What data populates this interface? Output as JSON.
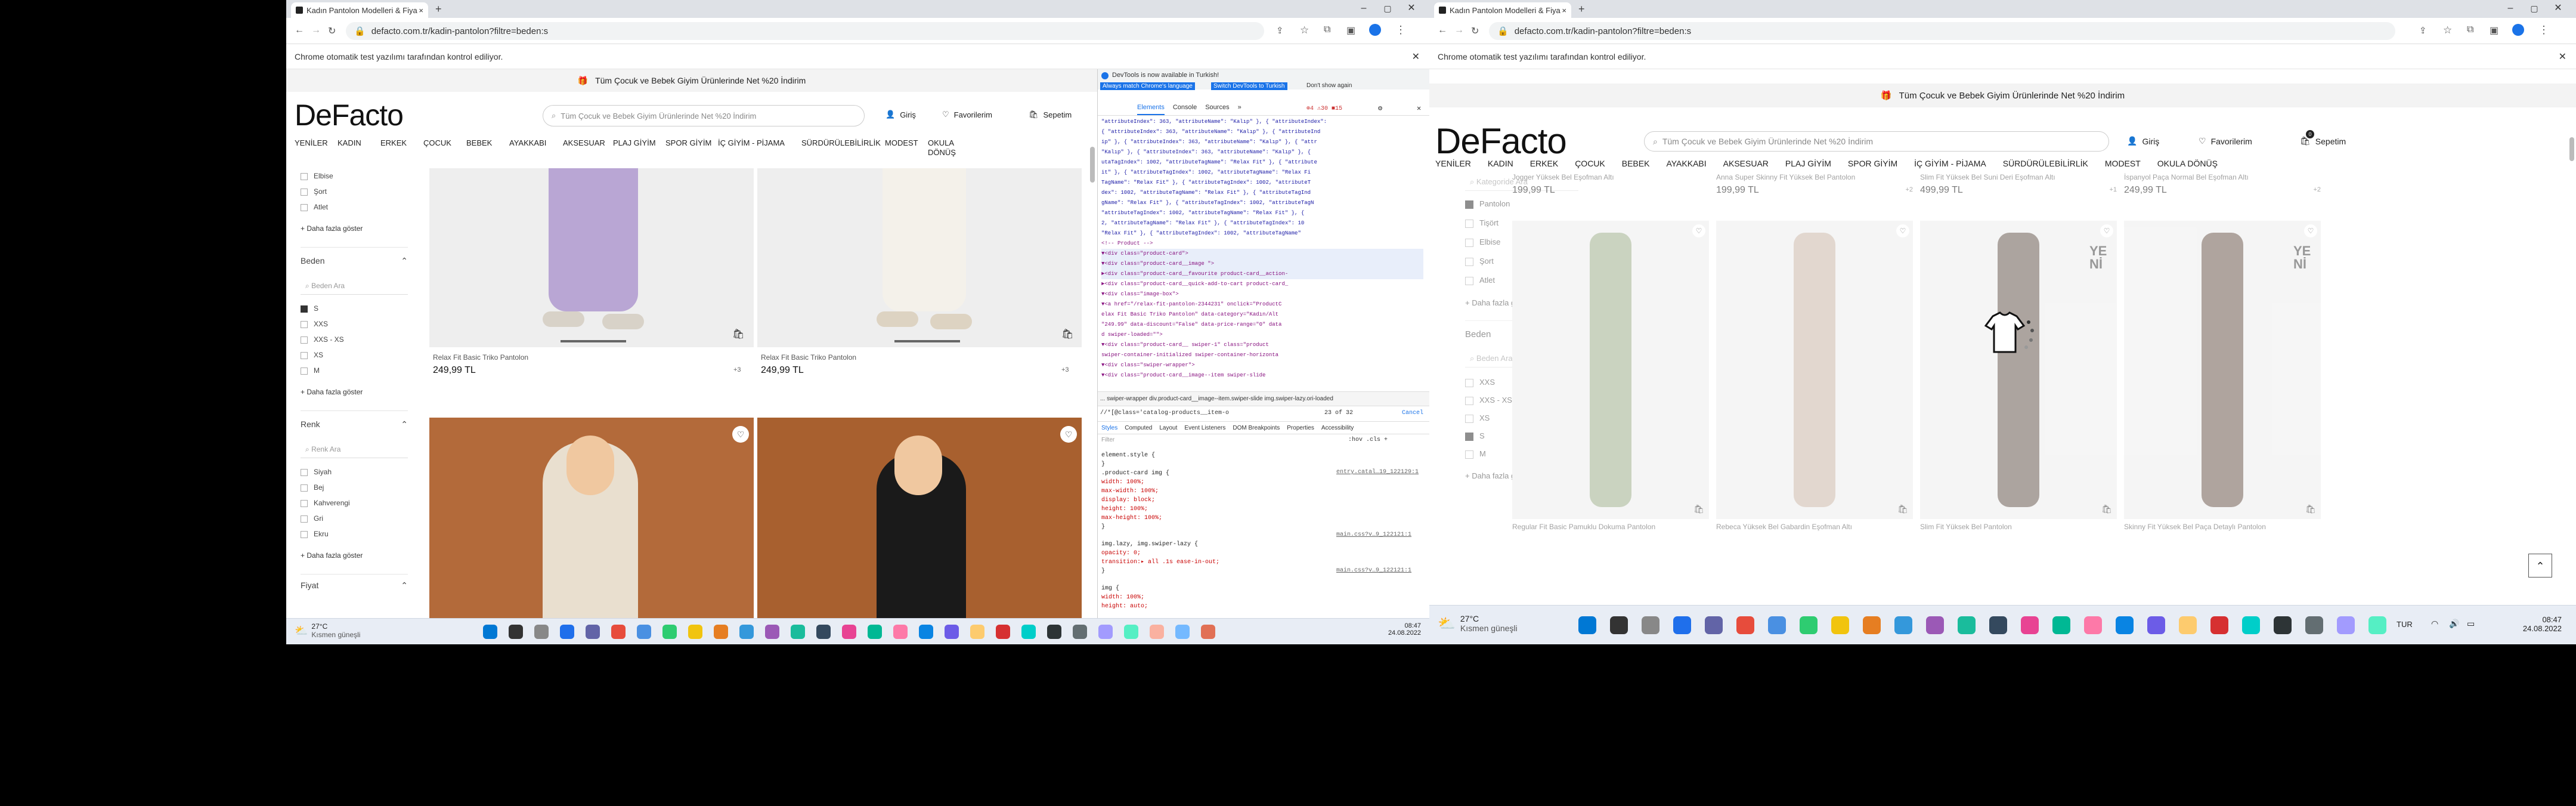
{
  "left": {
    "tab_title": "Kadın Pantolon Modelleri & Fiya",
    "url": "defacto.com.tr/kadin-pantolon?filtre=beden:s",
    "automation_banner": "Chrome otomatik test yazılımı tarafından kontrol ediliyor.",
    "promo": "Tüm Çocuk ve Bebek Giyim Ürünlerinde Net %20 İndirim",
    "logo": "DeFacto",
    "search_placeholder": "Tüm Çocuk ve Bebek Giyim Ürünlerinde Net %20 İndirim",
    "login": "Giriş",
    "favorites": "Favorilerim",
    "cart": "Sepetim",
    "cart_count": "0",
    "nav": [
      "YENİLER",
      "KADIN",
      "ERKEK",
      "ÇOCUK",
      "BEBEK",
      "AYAKKABI",
      "AKSESUAR",
      "PLAJ GİYİM",
      "SPOR GİYİM",
      "İÇ GİYİM - PİJAMA",
      "SÜRDÜRÜLEBİLİRLİK",
      "MODEST",
      "OKULA DÖNÜŞ"
    ],
    "filter_top": [
      "Elbise",
      "Şort",
      "Atlet"
    ],
    "more": "+ Daha fazla göster",
    "size_title": "Beden",
    "size_search": "Beden Ara",
    "sizes": [
      "S",
      "XXS",
      "XXS - XS",
      "XS",
      "M"
    ],
    "color_title": "Renk",
    "color_search": "Renk Ara",
    "colors": [
      "Siyah",
      "Bej",
      "Kahverengi",
      "Gri",
      "Ekru"
    ],
    "price_title": "Fiyat",
    "products": [
      {
        "name": "Relax Fit Basic Triko Pantolon",
        "price": "249,99 TL",
        "more": "+3"
      },
      {
        "name": "Relax Fit Basic Triko Pantolon",
        "price": "249,99 TL",
        "more": "+3"
      }
    ],
    "devtools": {
      "notice": "DevTools is now available in Turkish!",
      "btn1": "Always match Chrome's language",
      "btn2": "Switch DevTools to Turkish",
      "btn3": "Don't show again",
      "tabs": [
        "Elements",
        "Console",
        "Sources",
        "»"
      ],
      "badges": "⊗4 ⚠30 ■15",
      "code": [
        "\"attributeIndex\": 363, \"attributeName\": \"Kalıp\" }, { \"attributeIndex\":",
        "{ \"attributeIndex\": 363, \"attributeName\": \"Kalıp\" }, { \"attributeInd",
        "ip\" }, { \"attributeIndex\": 363, \"attributeName\": \"Kalıp\" }, { \"attr",
        "\"Kalıp\" }, { \"attributeIndex\": 363, \"attributeName\": \"Kalıp\" }, {",
        "utaTagIndex\": 1002, \"attributeTagName\": \"Relax Fit\" }, { \"attribute",
        "it\" }, { \"attributeTagIndex\": 1002, \"attributeTagName\": \"Relax Fi",
        "TagName\": \"Relax Fit\" }, { \"attributeTagIndex\": 1002, \"attributeT",
        "dex\": 1002, \"attributeTagName\": \"Relax Fit\" }, { \"attributeTagInd",
        "gName\": \"Relax Fit\" }, { \"attributeTagIndex\": 1002, \"attributeTagN",
        "\"attributeTagIndex\": 1002, \"attributeTagName\": \"Relax Fit\" }, {",
        "2, \"attributeTagName\": \"Relax Fit\" }, { \"attributeTagIndex\": 10",
        "\"Relax Fit\" }, { \"attributeTagIndex\": 1002, \"attributeTagName\"",
        "  <!-- Product -->",
        "  ▼<div class=\"product-card\">",
        "    ▼<div class=\"product-card__image \">",
        "      ►<div class=\"product-card__favourite product-card__action-",
        "      ►<div class=\"product-card__quick-add-to-cart product-card_",
        "      ▼<div class=\"image-box\">",
        "        ▼<a href=\"/relax-fit-pantolon-2344231\" onclick=\"ProductC",
        "          elax Fit Basic Triko Pantolon\" data-category=\"Kadın/Alt",
        "          \"249.99\" data-discount=\"False\" data-price-range=\"0\" data",
        "          d swiper-loaded=\"\">",
        "          ▼<div class=\"product-card__ swiper-1\" class=\"product",
        "            swiper-container-initialized swiper-container-horizonta",
        "            ▼<div class=\"swiper-wrapper\">",
        "              ▼<div class=\"product-card__image--item swiper-slide"
      ],
      "breadcrumb": "... swiper-wrapper   div.product-card__image--item.swiper-slide   img.swiper-lazy.ori-loaded",
      "search_text": "//*[@class='catalog-products__item-o",
      "search_count": "23 of 32",
      "cancel": "Cancel",
      "style_tabs": [
        "Styles",
        "Computed",
        "Layout",
        "Event Listeners",
        "DOM Breakpoints",
        "Properties",
        "Accessibility"
      ],
      "filter": "Filter",
      "hov": ":hov .cls +",
      "styles": [
        "element.style {",
        "}",
        ".product-card img {",
        "   width: 100%;",
        "   max-width: 100%;",
        "   display: block;",
        "   height: 100%;",
        "   max-height: 100%;",
        "}",
        "img.lazy, img.swiper-lazy {",
        "   opacity: 0;",
        "   transition:▸ all .1s ease-in-out;",
        "}",
        "img {",
        "   width: 100%;",
        "   height: auto;"
      ],
      "style_src": [
        "entry.catal…19_122129:1",
        "main.css?v…9_122121:1",
        "main.css?v…9_122121:1"
      ]
    },
    "weather": "27°C",
    "weather_desc": "Kısmen güneşli",
    "time": "08:47",
    "date": "24.08.2022"
  },
  "right": {
    "tab_title": "Kadın Pantolon Modelleri & Fiya",
    "url": "defacto.com.tr/kadin-pantolon?filtre=beden:s",
    "automation_banner": "Chrome otomatik test yazılımı tarafından kontrol ediliyor.",
    "promo": "Tüm Çocuk ve Bebek Giyim Ürünlerinde Net %20 İndirim",
    "logo": "DeFacto",
    "search_placeholder": "Tüm Çocuk ve Bebek Giyim Ürünlerinde Net %20 İndirim",
    "login": "Giriş",
    "favorites": "Favorilerim",
    "cart": "Sepetim",
    "cart_count": "0",
    "nav": [
      "YENİLER",
      "KADIN",
      "ERKEK",
      "ÇOCUK",
      "BEBEK",
      "AYAKKABI",
      "AKSESUAR",
      "PLAJ GİYİM",
      "SPOR GİYİM",
      "İÇ GİYİM - PİJAMA",
      "SÜRDÜRÜLEBİLİRLİK",
      "MODEST",
      "OKULA DÖNÜŞ"
    ],
    "cat_search": "Kategoride Ara",
    "categories": [
      "Pantolon",
      "Tişört",
      "Elbise",
      "Şort",
      "Atlet"
    ],
    "more": "+ Daha fazla göster",
    "size_title": "Beden",
    "size_search": "Beden Ara",
    "sizes": [
      "XXS",
      "XXS - XS",
      "XS",
      "S",
      "M"
    ],
    "top_products": [
      {
        "name": "Jogger Yüksek Bel Eşofman Altı",
        "price": "199,99 TL",
        "more": ""
      },
      {
        "name": "Anna Super Skinny Fit Yüksek Bel Pantolon",
        "price": "199,99 TL",
        "more": "+2"
      },
      {
        "name": "Slim Fit Yüksek Bel Suni Deri Eşofman Altı",
        "price": "499,99 TL",
        "more": "+1"
      },
      {
        "name": "İspanyol Paça Normal Bel Eşofman Altı",
        "price": "249,99 TL",
        "more": "+2"
      }
    ],
    "bottom_products": [
      {
        "name": "Regular Fit Basic Pamuklu Dokuma Pantolon",
        "badge": ""
      },
      {
        "name": "Rebeca Yüksek Bel Gabardin Eşofman Altı",
        "badge": ""
      },
      {
        "name": "Slim Fit Yüksek Bel Pantolon",
        "badge": "YENİ"
      },
      {
        "name": "Skinny Fit Yüksek Bel Paça Detaylı Pantolon",
        "badge": "YENİ"
      }
    ],
    "weather": "27°C",
    "weather_desc": "Kısmen güneşli",
    "lang": "TUR",
    "time": "08:47",
    "date": "24.08.2022"
  }
}
